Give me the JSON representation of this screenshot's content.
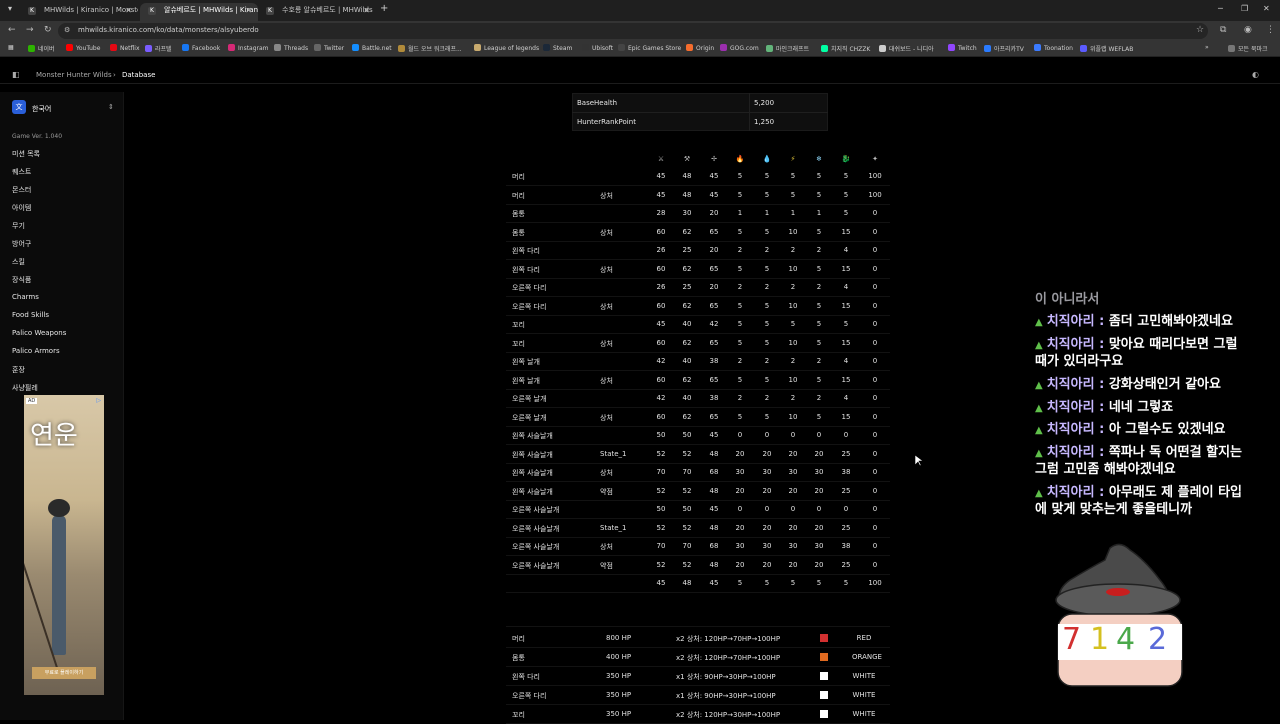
{
  "browser": {
    "tabs": [
      {
        "label": "MHWilds | Kiranico | Monster"
      },
      {
        "label": "알슈베르도 | MHWilds | Kirani"
      },
      {
        "label": "수호룡 알슈베르도 | MHWilds"
      }
    ],
    "new_tab": "+",
    "url": "mhwilds.kiranico.com/ko/data/monsters/alsyuberdo",
    "bookmarks": [
      "네이버",
      "YouTube",
      "Netflix",
      "라프텔",
      "Facebook",
      "Instagram",
      "Threads",
      "Twitter",
      "Battle.net",
      "월드 오브 워크래프...",
      "League of legends",
      "Steam",
      "Ubisoft",
      "Epic Games Store",
      "Origin",
      "GOG.com",
      "마인크래프트",
      "치지직 CHZZK",
      "대쉬보드 - 니디아",
      "Twitch",
      "아프리카TV",
      "Toonation",
      "위플랩 WEFLAB"
    ],
    "all_bookmarks": "모든 북마크"
  },
  "site": {
    "breadcrumb_root": "Monster Hunter Wilds",
    "breadcrumb_current": "Database"
  },
  "sidebar": {
    "language": "한국어",
    "game_version": "Game Ver. 1.040",
    "items": [
      "미션 목록",
      "퀘스트",
      "몬스터",
      "아이템",
      "무기",
      "방어구",
      "스킬",
      "장식품",
      "Charms",
      "Food Skills",
      "Palico Weapons",
      "Palico Armors",
      "훈장",
      "사냥필레"
    ],
    "ad_label": "AD",
    "ad_title": "연운",
    "ad_button": "무료로 플레이하기"
  },
  "stats": {
    "base_health_label": "BaseHealth",
    "base_health_value": "5,200",
    "rank_label": "HunterRankPoint",
    "rank_value": "1,250"
  },
  "hitzone_headers": [
    "⚔",
    "⚒",
    "✢",
    "🔥",
    "💧",
    "⚡",
    "❄",
    "🐉",
    "✦"
  ],
  "hitzones": [
    {
      "part": "머리",
      "state": "",
      "v": [
        "45",
        "48",
        "45",
        "5",
        "5",
        "5",
        "5",
        "5",
        "100"
      ]
    },
    {
      "part": "머리",
      "state": "상처",
      "v": [
        "45",
        "48",
        "45",
        "5",
        "5",
        "5",
        "5",
        "5",
        "100"
      ]
    },
    {
      "part": "몸통",
      "state": "",
      "v": [
        "28",
        "30",
        "20",
        "1",
        "1",
        "1",
        "1",
        "5",
        "0"
      ]
    },
    {
      "part": "몸통",
      "state": "상처",
      "v": [
        "60",
        "62",
        "65",
        "5",
        "5",
        "10",
        "5",
        "15",
        "0"
      ]
    },
    {
      "part": "왼쪽 다리",
      "state": "",
      "v": [
        "26",
        "25",
        "20",
        "2",
        "2",
        "2",
        "2",
        "4",
        "0"
      ]
    },
    {
      "part": "왼쪽 다리",
      "state": "상처",
      "v": [
        "60",
        "62",
        "65",
        "5",
        "5",
        "10",
        "5",
        "15",
        "0"
      ]
    },
    {
      "part": "오른쪽 다리",
      "state": "",
      "v": [
        "26",
        "25",
        "20",
        "2",
        "2",
        "2",
        "2",
        "4",
        "0"
      ]
    },
    {
      "part": "오른쪽 다리",
      "state": "상처",
      "v": [
        "60",
        "62",
        "65",
        "5",
        "5",
        "10",
        "5",
        "15",
        "0"
      ]
    },
    {
      "part": "꼬리",
      "state": "",
      "v": [
        "45",
        "40",
        "42",
        "5",
        "5",
        "5",
        "5",
        "5",
        "0"
      ]
    },
    {
      "part": "꼬리",
      "state": "상처",
      "v": [
        "60",
        "62",
        "65",
        "5",
        "5",
        "10",
        "5",
        "15",
        "0"
      ]
    },
    {
      "part": "왼쪽 날개",
      "state": "",
      "v": [
        "42",
        "40",
        "38",
        "2",
        "2",
        "2",
        "2",
        "4",
        "0"
      ]
    },
    {
      "part": "왼쪽 날개",
      "state": "상처",
      "v": [
        "60",
        "62",
        "65",
        "5",
        "5",
        "10",
        "5",
        "15",
        "0"
      ]
    },
    {
      "part": "오른쪽 날개",
      "state": "",
      "v": [
        "42",
        "40",
        "38",
        "2",
        "2",
        "2",
        "2",
        "4",
        "0"
      ]
    },
    {
      "part": "오른쪽 날개",
      "state": "상처",
      "v": [
        "60",
        "62",
        "65",
        "5",
        "5",
        "10",
        "5",
        "15",
        "0"
      ]
    },
    {
      "part": "왼쪽 사슬날개",
      "state": "",
      "v": [
        "50",
        "50",
        "45",
        "0",
        "0",
        "0",
        "0",
        "0",
        "0"
      ]
    },
    {
      "part": "왼쪽 사슬날개",
      "state": "State_1",
      "v": [
        "52",
        "52",
        "48",
        "20",
        "20",
        "20",
        "20",
        "25",
        "0"
      ]
    },
    {
      "part": "왼쪽 사슬날개",
      "state": "상처",
      "v": [
        "70",
        "70",
        "68",
        "30",
        "30",
        "30",
        "30",
        "38",
        "0"
      ]
    },
    {
      "part": "왼쪽 사슬날개",
      "state": "약점",
      "v": [
        "52",
        "52",
        "48",
        "20",
        "20",
        "20",
        "20",
        "25",
        "0"
      ]
    },
    {
      "part": "오른쪽 사슬날개",
      "state": "",
      "v": [
        "50",
        "50",
        "45",
        "0",
        "0",
        "0",
        "0",
        "0",
        "0"
      ]
    },
    {
      "part": "오른쪽 사슬날개",
      "state": "State_1",
      "v": [
        "52",
        "52",
        "48",
        "20",
        "20",
        "20",
        "20",
        "25",
        "0"
      ]
    },
    {
      "part": "오른쪽 사슬날개",
      "state": "상처",
      "v": [
        "70",
        "70",
        "68",
        "30",
        "30",
        "30",
        "30",
        "38",
        "0"
      ]
    },
    {
      "part": "오른쪽 사슬날개",
      "state": "약점",
      "v": [
        "52",
        "52",
        "48",
        "20",
        "20",
        "20",
        "20",
        "25",
        "0"
      ]
    },
    {
      "part": "",
      "state": "",
      "v": [
        "45",
        "48",
        "45",
        "5",
        "5",
        "5",
        "5",
        "5",
        "100"
      ]
    }
  ],
  "breakparts": [
    {
      "part": "머리",
      "hp": "800 HP",
      "detail": "x2 상처: 120HP→70HP→100HP",
      "color": "#d23030",
      "label": "RED"
    },
    {
      "part": "몸통",
      "hp": "400 HP",
      "detail": "x2 상처: 120HP→70HP→100HP",
      "color": "#e06a20",
      "label": "ORANGE"
    },
    {
      "part": "왼쪽 다리",
      "hp": "350 HP",
      "detail": "x1 상처: 90HP→30HP→100HP",
      "color": "#ffffff",
      "label": "WHITE"
    },
    {
      "part": "오른쪽 다리",
      "hp": "350 HP",
      "detail": "x1 상처: 90HP→30HP→100HP",
      "color": "#ffffff",
      "label": "WHITE"
    },
    {
      "part": "꼬리",
      "hp": "350 HP",
      "detail": "x2 상처: 120HP→30HP→100HP",
      "color": "#ffffff",
      "label": "WHITE"
    }
  ],
  "chat": {
    "partial_top": "이 아니라서",
    "lines": [
      {
        "name": "치직아리",
        "msg": "좀더 고민해봐야겠네요"
      },
      {
        "name": "치직아리",
        "msg": "맞아요 때리다보면 그럴"
      },
      {
        "name": "",
        "msg": "때가 있더라구요"
      },
      {
        "name": "치직아리",
        "msg": "강화상태인거 같아요"
      },
      {
        "name": "치직아리",
        "msg": "네네 그렇죠"
      },
      {
        "name": "치직아리",
        "msg": "아 그럴수도 있겠네요"
      },
      {
        "name": "치직아리",
        "msg": "쪽파나 독 어떤걸 할지는"
      },
      {
        "name": "",
        "msg": "그럼 고민좀 해봐야겠네요"
      },
      {
        "name": "치직아리",
        "msg": "아무래도 제 플레이 타입"
      },
      {
        "name": "",
        "msg": "에 맞게 맞추는게 좋을테니까"
      }
    ]
  },
  "mascot": {
    "digits": [
      "7",
      "1",
      "4",
      "2"
    ]
  }
}
